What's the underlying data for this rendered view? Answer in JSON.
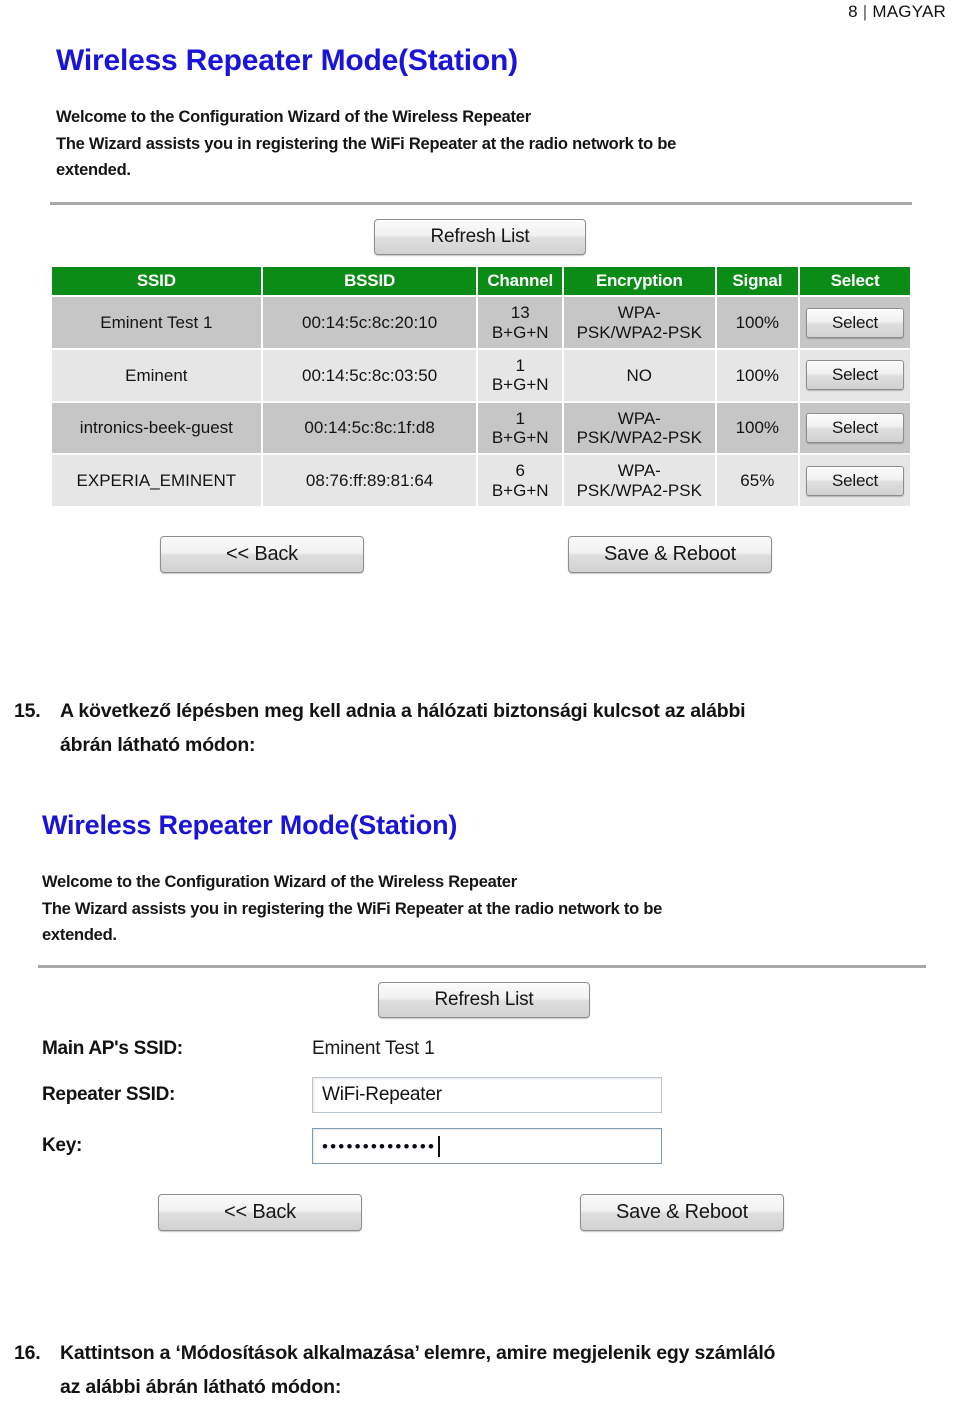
{
  "page_header": {
    "number": "8",
    "separator": "|",
    "section": "MAGYAR"
  },
  "figure1": {
    "title": "Wireless Repeater Mode(Station)",
    "welcome_line1": "Welcome to the Configuration Wizard of the Wireless Repeater",
    "welcome_line2": "The Wizard assists you in registering the WiFi Repeater at the radio network to be",
    "welcome_line3": "extended.",
    "refresh_button": "Refresh List",
    "table": {
      "columns": [
        "SSID",
        "BSSID",
        "Channel",
        "Encryption",
        "Signal",
        "Select"
      ],
      "rows": [
        {
          "ssid": "Eminent Test 1",
          "bssid": "00:14:5c:8c:20:10",
          "channel": "13",
          "channel_band": "B+G+N",
          "encryption_line1": "WPA-",
          "encryption_line2": "PSK/WPA2-PSK",
          "signal": "100%",
          "select": "Select"
        },
        {
          "ssid": "Eminent",
          "bssid": "00:14:5c:8c:03:50",
          "channel": "1",
          "channel_band": "B+G+N",
          "encryption_line1": "NO",
          "encryption_line2": "",
          "signal": "100%",
          "select": "Select"
        },
        {
          "ssid": "intronics-beek-guest",
          "bssid": "00:14:5c:8c:1f:d8",
          "channel": "1",
          "channel_band": "B+G+N",
          "encryption_line1": "WPA-",
          "encryption_line2": "PSK/WPA2-PSK",
          "signal": "100%",
          "select": "Select"
        },
        {
          "ssid": "EXPERIA_EMINENT",
          "bssid": "08:76:ff:89:81:64",
          "channel": "6",
          "channel_band": "B+G+N",
          "encryption_line1": "WPA-",
          "encryption_line2": "PSK/WPA2-PSK",
          "signal": "65%",
          "select": "Select"
        }
      ]
    },
    "back_button": "<< Back",
    "save_button": "Save & Reboot"
  },
  "step15": {
    "number": "15.",
    "line1": "A következő lépésben meg kell adnia a hálózati biztonsági kulcsot az alábbi",
    "line2": "ábrán látható módon:"
  },
  "figure2": {
    "title": "Wireless Repeater Mode(Station)",
    "welcome_line1": "Welcome to the Configuration Wizard of the Wireless Repeater",
    "welcome_line2": "The Wizard assists you in registering the WiFi Repeater at the radio network to be",
    "welcome_line3": "extended.",
    "refresh_button": "Refresh List",
    "fields": {
      "main_ap_ssid_label": "Main AP's SSID:",
      "main_ap_ssid_value": "Eminent Test 1",
      "repeater_ssid_label": "Repeater SSID:",
      "repeater_ssid_value": "WiFi-Repeater",
      "key_label": "Key:",
      "key_value_masked": "••••••••••••••"
    },
    "back_button": "<< Back",
    "save_button": "Save & Reboot"
  },
  "step16": {
    "number": "16.",
    "line1": "Kattintson a ‘Módosítások alkalmazása’ elemre, amire megjelenik egy számláló",
    "line2": "az alábbi ábrán látható módon:"
  }
}
